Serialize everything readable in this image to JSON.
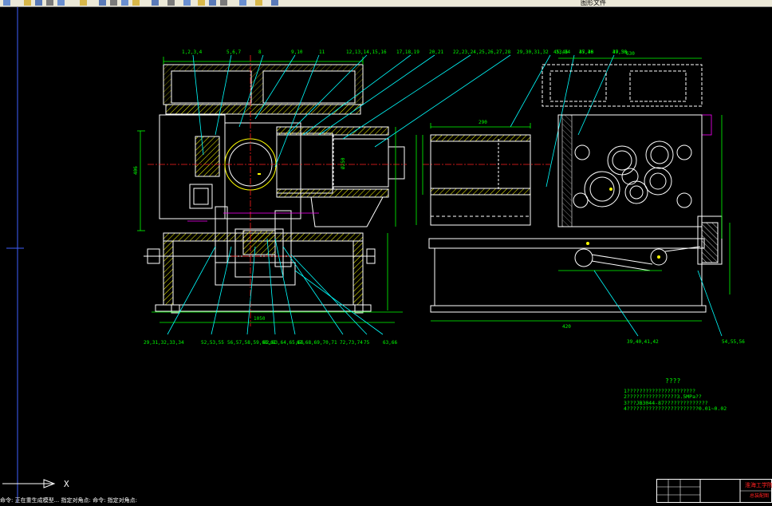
{
  "toolbar": {
    "title_fragment": "图形文件",
    "buttons": [
      "new-icon",
      "open-icon",
      "save-icon",
      "print-icon",
      "preview-icon",
      "cut-icon",
      "copy-icon",
      "paste-icon",
      "match-icon",
      "undo-icon",
      "redo-icon",
      "pan-icon",
      "zoom-icon",
      "zoom-window-icon",
      "zoom-prev-icon",
      "properties-icon",
      "design-center-icon",
      "tool-palette-icon",
      "help-icon"
    ]
  },
  "front_view_callouts": [
    "1,2,3,4",
    "5,6,7",
    "8",
    "9,10",
    "11",
    "12,13,14,15,16",
    "17,18,19",
    "20,21",
    "22,23,24,25,26,27,28",
    "29,30,31,32",
    "33,34",
    "35,36",
    "37,38"
  ],
  "bottom_callouts": [
    "29,31,32,33,34",
    "52,53,55",
    "56,57,58,59,60,61",
    "62,63,64,65,66",
    "67,68,69,70,71",
    "72,73,74",
    "75",
    "63,66"
  ],
  "side_view_callouts": [
    "45,46",
    "47,48",
    "49,50",
    "39,40,41,42",
    "54,55,56"
  ],
  "dimensions": {
    "width_total": "1050",
    "height_main": "406",
    "side_top": "630",
    "side_dim1": "420",
    "side_dim2": "290",
    "pipe": "Ø250",
    "left_a": "490",
    "left_b": "250"
  },
  "notes": {
    "title": "????",
    "lines": [
      "1??????????????????????",
      "2????????????????3.5MPa??",
      "3???JB3044-87??????????????",
      "4???????????????????????0.01~0.02"
    ]
  },
  "title_block": {
    "school": "淮海工学院",
    "drawing": "总装配图"
  },
  "command_line": "命令: 正在重生成模型...   指定对角点:   命令: 指定对角点:",
  "colors": {
    "outline": "#ffffff",
    "dim": "#00ff00",
    "leader": "#00ffff",
    "center": "#ff2020",
    "hidden": "#ff00ff",
    "hatch": "#ffff00",
    "ucs": "#4060ff"
  }
}
